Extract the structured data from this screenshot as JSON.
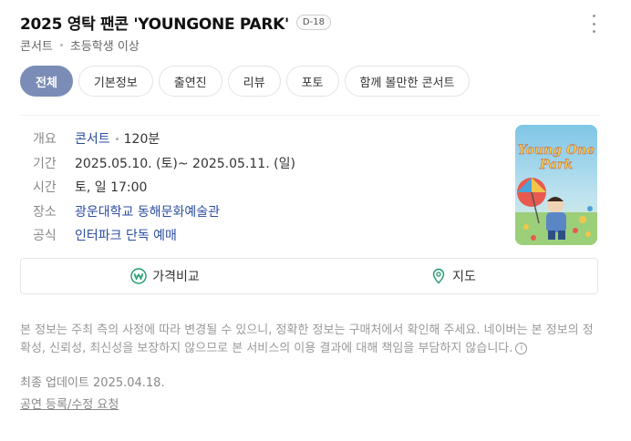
{
  "header": {
    "title": "2025 영탁 팬콘 'YOUNGONE PARK'",
    "dday": "D-18",
    "more_icon": "more-vertical-icon"
  },
  "subtitle": {
    "category": "콘서트",
    "age": "초등학생 이상"
  },
  "tabs": [
    {
      "label": "전체",
      "active": true
    },
    {
      "label": "기본정보",
      "active": false
    },
    {
      "label": "출연진",
      "active": false
    },
    {
      "label": "리뷰",
      "active": false
    },
    {
      "label": "포토",
      "active": false
    },
    {
      "label": "함께 볼만한 콘서트",
      "active": false
    }
  ],
  "info": {
    "overview": {
      "key": "개요",
      "category": "콘서트",
      "runtime": "120분"
    },
    "period": {
      "key": "기간",
      "value": "2025.05.10. (토)~ 2025.05.11. (일)"
    },
    "time": {
      "key": "시간",
      "value": "토, 일 17:00"
    },
    "venue": {
      "key": "장소",
      "value": "광운대학교 동해문화예술관"
    },
    "official": {
      "key": "공식",
      "value": "인터파크 단독 예매"
    }
  },
  "poster": {
    "text_line1": "Young One",
    "text_line2": "Park",
    "accent": "#f3c64b"
  },
  "actions": {
    "price_compare": {
      "label": "가격비교",
      "icon": "won-icon"
    },
    "map": {
      "label": "지도",
      "icon": "map-pin-icon"
    }
  },
  "notice": {
    "text": "본 정보는 주최 측의 사정에 따라 변경될 수 있으니, 정확한 정보는 구매처에서 확인해 주세요. 네이버는 본 정보의 정확성, 신뢰성, 최신성을 보장하지 않으므로 본 서비스의 이용 결과에 대해 책임을 부담하지 않습니다.",
    "info_icon": "info-icon",
    "info_glyph": "i",
    "updated": "최종 업데이트 2025.04.18.",
    "report_link": "공연 등록/수정 요청"
  },
  "colors": {
    "tab_active": "#7b8cb6",
    "link": "#2b4da0",
    "icon_green": "#1f9d6b"
  }
}
